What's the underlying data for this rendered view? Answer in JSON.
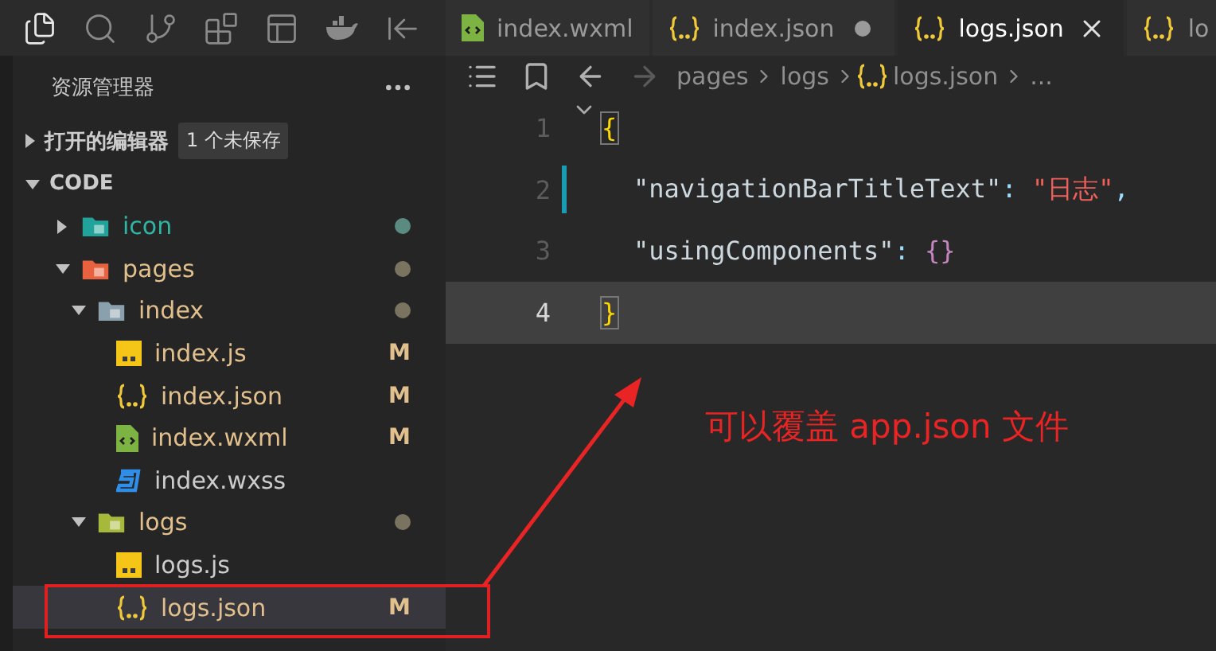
{
  "activity_bar": {
    "icons": [
      {
        "kind": "files",
        "selected": true
      },
      {
        "kind": "search",
        "selected": false
      },
      {
        "kind": "branch",
        "selected": false
      },
      {
        "kind": "blocks",
        "selected": false
      },
      {
        "kind": "panel",
        "selected": false
      },
      {
        "kind": "whale",
        "selected": false
      },
      {
        "kind": "sidebar-arrow",
        "selected": false
      }
    ]
  },
  "sidebar": {
    "title": "资源管理器",
    "sections": [
      {
        "label": "打开的编辑器",
        "expanded": false,
        "badge": "1 个未保存"
      },
      {
        "label": "CODE",
        "expanded": true
      }
    ],
    "tree": [
      {
        "label": "icon",
        "kind": "folder",
        "color": "#1fa39a",
        "expanded": false,
        "untracked": true,
        "modified": false,
        "selected": false
      },
      {
        "label": "pages",
        "kind": "folder",
        "color": "#e8623f",
        "expanded": true,
        "untracked": false,
        "modified": true,
        "selected": false,
        "children": [
          {
            "label": "index",
            "kind": "folder",
            "color": "#8aa0ad",
            "expanded": true,
            "untracked": false,
            "modified": true,
            "selected": false,
            "children": [
              {
                "label": "index.js",
                "kind": "js",
                "untracked": false,
                "modified": true,
                "status": "M",
                "selected": false
              },
              {
                "label": "index.json",
                "kind": "json",
                "untracked": false,
                "modified": true,
                "status": "M",
                "selected": false
              },
              {
                "label": "index.wxml",
                "kind": "wxml",
                "untracked": false,
                "modified": true,
                "status": "M",
                "selected": false
              },
              {
                "label": "index.wxss",
                "kind": "wxss",
                "untracked": false,
                "modified": false,
                "selected": false
              }
            ]
          },
          {
            "label": "logs",
            "kind": "folder",
            "color": "#a6b93a",
            "expanded": true,
            "untracked": false,
            "modified": true,
            "selected": false,
            "children": [
              {
                "label": "logs.js",
                "kind": "js",
                "untracked": false,
                "modified": false,
                "selected": false
              },
              {
                "label": "logs.json",
                "kind": "json",
                "untracked": false,
                "modified": true,
                "status": "M",
                "selected": true
              }
            ]
          }
        ]
      }
    ]
  },
  "tabs": [
    {
      "label": "index.wxml",
      "kind": "wxml",
      "selected": false,
      "modified": false
    },
    {
      "label": "index.json",
      "kind": "json",
      "selected": false,
      "modified": true
    },
    {
      "label": "logs.json",
      "kind": "json",
      "selected": true,
      "modified": false
    },
    {
      "label": "lo",
      "kind": "json",
      "selected": false
    }
  ],
  "breadcrumb": [
    {
      "label": "pages",
      "kind": "folder"
    },
    {
      "label": "logs",
      "kind": "folder"
    },
    {
      "label": "logs.json",
      "kind": "json"
    },
    {
      "label": "...",
      "kind": "more"
    }
  ],
  "code": [
    {
      "number": "1",
      "current": false,
      "changed": false,
      "foldable": true,
      "indented": false,
      "tokens": [
        {
          "text": "{",
          "kind": "bracket",
          "matched": true
        }
      ]
    },
    {
      "number": "2",
      "current": false,
      "changed": true,
      "foldable": false,
      "indented": true,
      "tokens": [
        {
          "text": "\"navigationBarTitleText\"",
          "kind": "key",
          "matched": false
        },
        {
          "text": ": ",
          "kind": "punct",
          "matched": false
        },
        {
          "text": "\"日志\"",
          "kind": "string",
          "matched": false
        },
        {
          "text": ",",
          "kind": "punct",
          "matched": false
        }
      ]
    },
    {
      "number": "3",
      "current": false,
      "changed": false,
      "foldable": false,
      "indented": true,
      "tokens": [
        {
          "text": "\"usingComponents\"",
          "kind": "key",
          "matched": false
        },
        {
          "text": ": ",
          "kind": "punct",
          "matched": false
        },
        {
          "text": "{}",
          "kind": "brace2",
          "matched": false
        }
      ]
    },
    {
      "number": "4",
      "current": true,
      "changed": false,
      "foldable": false,
      "indented": false,
      "tokens": [
        {
          "text": "}",
          "kind": "bracket",
          "matched": true
        }
      ]
    }
  ],
  "annotation": {
    "label": "可以覆盖 app.json 文件"
  }
}
